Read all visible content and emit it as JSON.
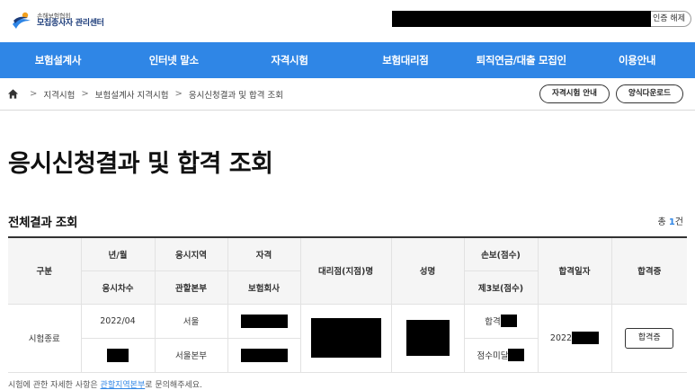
{
  "header": {
    "logo_sub": "손해보험협회",
    "logo_main": "모집종사자 관리센터",
    "auth_release_label": "인증 해제"
  },
  "gnb": {
    "items": [
      "보험설계사",
      "인터넷 말소",
      "자격시험",
      "보험대리점",
      "퇴직연금/대출 모집인",
      "이용안내"
    ]
  },
  "breadcrumb": {
    "items": [
      "지격시험",
      "보험설계사 지격시험",
      "응시신청결과 및 합격 조회"
    ],
    "separator": ">"
  },
  "actions": {
    "exam_guide": "자격시험 안내",
    "form_download": "양식다운로드"
  },
  "page": {
    "title": "응시신청결과 및 합격 조회",
    "section_title": "전체결과 조회",
    "total_prefix": "총",
    "total_count": "1",
    "total_suffix": "건"
  },
  "table": {
    "headers": {
      "category": "구분",
      "year_month": "년/월",
      "exam_round": "응시차수",
      "exam_region": "응시지역",
      "jurisdiction": "관할본부",
      "qualification": "자격",
      "insurer": "보험회사",
      "agency_name": "대리점(지점)명",
      "name": "성명",
      "non_life_score": "손보(점수)",
      "third_score": "제3보(점수)",
      "pass_date": "합격일자",
      "certificate": "합격증"
    },
    "row": {
      "category": "시험종료",
      "year_month": "2022/04",
      "exam_region": "서울",
      "jurisdiction": "서울본부",
      "non_life_result": "합격",
      "third_result": "점수미달",
      "pass_date_prefix": "2022",
      "certificate_button": "합격증"
    }
  },
  "footnote": {
    "text_before": "시험에 관한 자세한 사항은",
    "link": "관할지역본부",
    "text_after": "로 문의해주세요."
  },
  "colors": {
    "gnb_background": "#2f86e6",
    "accent": "#2f86e6",
    "redaction": "#000000"
  }
}
